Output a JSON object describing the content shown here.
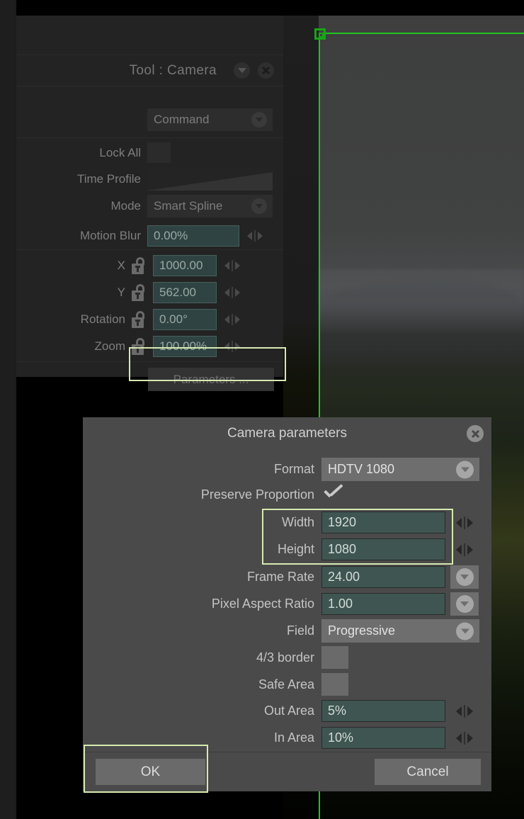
{
  "tool_panel": {
    "title": "Tool : Camera",
    "header_collapse_icon": "chevron-down-icon",
    "header_close_icon": "close-icon",
    "command_label": "Command",
    "rows": [
      {
        "label": "Lock All",
        "type": "checkbox",
        "value": ""
      },
      {
        "label": "Time Profile",
        "type": "ramp",
        "value": ""
      },
      {
        "label": "Mode",
        "type": "dropdown",
        "value": "Smart Spline"
      },
      {
        "label": "Motion Blur",
        "type": "number",
        "value": "0.00%"
      },
      {
        "label": "X",
        "type": "number-lock",
        "value": "1000.00"
      },
      {
        "label": "Y",
        "type": "number-lock",
        "value": "562.00"
      },
      {
        "label": "Rotation",
        "type": "number-lock",
        "value": "0.00°"
      },
      {
        "label": "Zoom",
        "type": "number-lock",
        "value": "100.00%"
      }
    ],
    "parameters_button": "Parameters ..."
  },
  "dialog": {
    "title": "Camera parameters",
    "close_icon": "close-icon",
    "fields": {
      "format_label": "Format",
      "format_value": "HDTV 1080",
      "preserve_label": "Preserve Proportion",
      "preserve_checked": "checkmark-icon",
      "width_label": "Width",
      "width_value": "1920",
      "height_label": "Height",
      "height_value": "1080",
      "frame_rate_label": "Frame Rate",
      "frame_rate_value": "24.00",
      "par_label": "Pixel Aspect Ratio",
      "par_value": "1.00",
      "field_label": "Field",
      "field_value": "Progressive",
      "border_label": "4/3 border",
      "safe_area_label": "Safe Area",
      "out_area_label": "Out Area",
      "out_area_value": "5%",
      "in_area_label": "In Area",
      "in_area_value": "10%"
    },
    "ok_button": "OK",
    "cancel_button": "Cancel"
  },
  "viewport": {
    "camera_frame_color": "#1fc41f",
    "handle_icon": "camera-corner-handle-icon"
  },
  "highlight_color": "#d6e9b0"
}
